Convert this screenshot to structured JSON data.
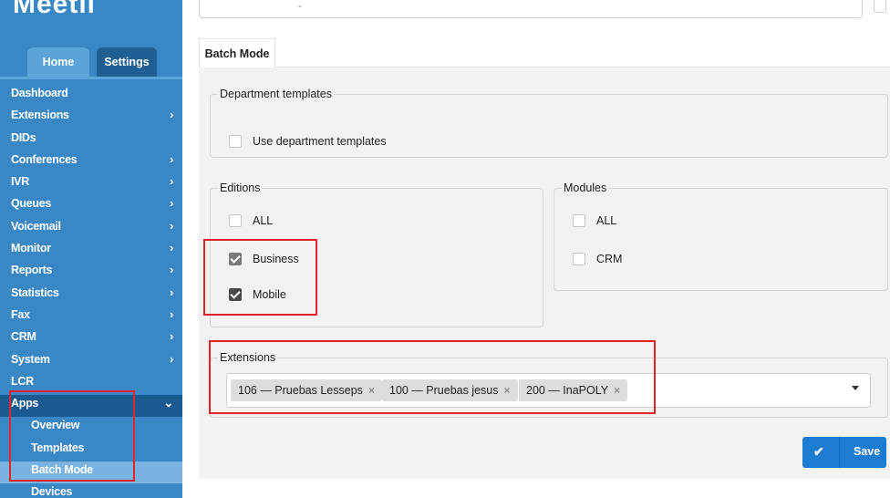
{
  "sidebar": {
    "logo": "Meetii",
    "tabs": [
      "Home",
      "Settings"
    ],
    "items": [
      {
        "label": "Dashboard",
        "chevron": ""
      },
      {
        "label": "Extensions",
        "chevron": "›"
      },
      {
        "label": "DIDs",
        "chevron": ""
      },
      {
        "label": "Conferences",
        "chevron": "›"
      },
      {
        "label": "IVR",
        "chevron": "›"
      },
      {
        "label": "Queues",
        "chevron": "›"
      },
      {
        "label": "Voicemail",
        "chevron": "›"
      },
      {
        "label": "Monitor",
        "chevron": "›"
      },
      {
        "label": "Reports",
        "chevron": "›"
      },
      {
        "label": "Statistics",
        "chevron": "›"
      },
      {
        "label": "Fax",
        "chevron": "›"
      },
      {
        "label": "CRM",
        "chevron": "›"
      },
      {
        "label": "System",
        "chevron": "›"
      },
      {
        "label": "LCR",
        "chevron": ""
      },
      {
        "label": "Apps",
        "chevron": "⌄"
      },
      {
        "label": "Overview",
        "chevron": ""
      },
      {
        "label": "Templates",
        "chevron": ""
      },
      {
        "label": "Batch Mode",
        "chevron": ""
      },
      {
        "label": "Devices",
        "chevron": ""
      }
    ]
  },
  "main": {
    "tab": "Batch Mode",
    "department": {
      "legend": "Department templates",
      "option": "Use department templates"
    },
    "editions": {
      "legend": "Editions",
      "options": [
        "ALL",
        "Business",
        "Mobile"
      ]
    },
    "modules": {
      "legend": "Modules",
      "options": [
        "ALL",
        "CRM"
      ]
    },
    "extensions": {
      "legend": "Extensions",
      "chips": [
        "106 — Pruebas Lesseps",
        "100 — Pruebas jesus",
        "200 — InaPOLY"
      ],
      "remove_glyph": "×"
    },
    "save_label": "Save",
    "save_icon": "✔"
  },
  "colors": {
    "sidebar": "#3a87c6",
    "active_item": "#7ab3e0",
    "highlight": "#e0242b",
    "save": "#1d7bd2"
  }
}
